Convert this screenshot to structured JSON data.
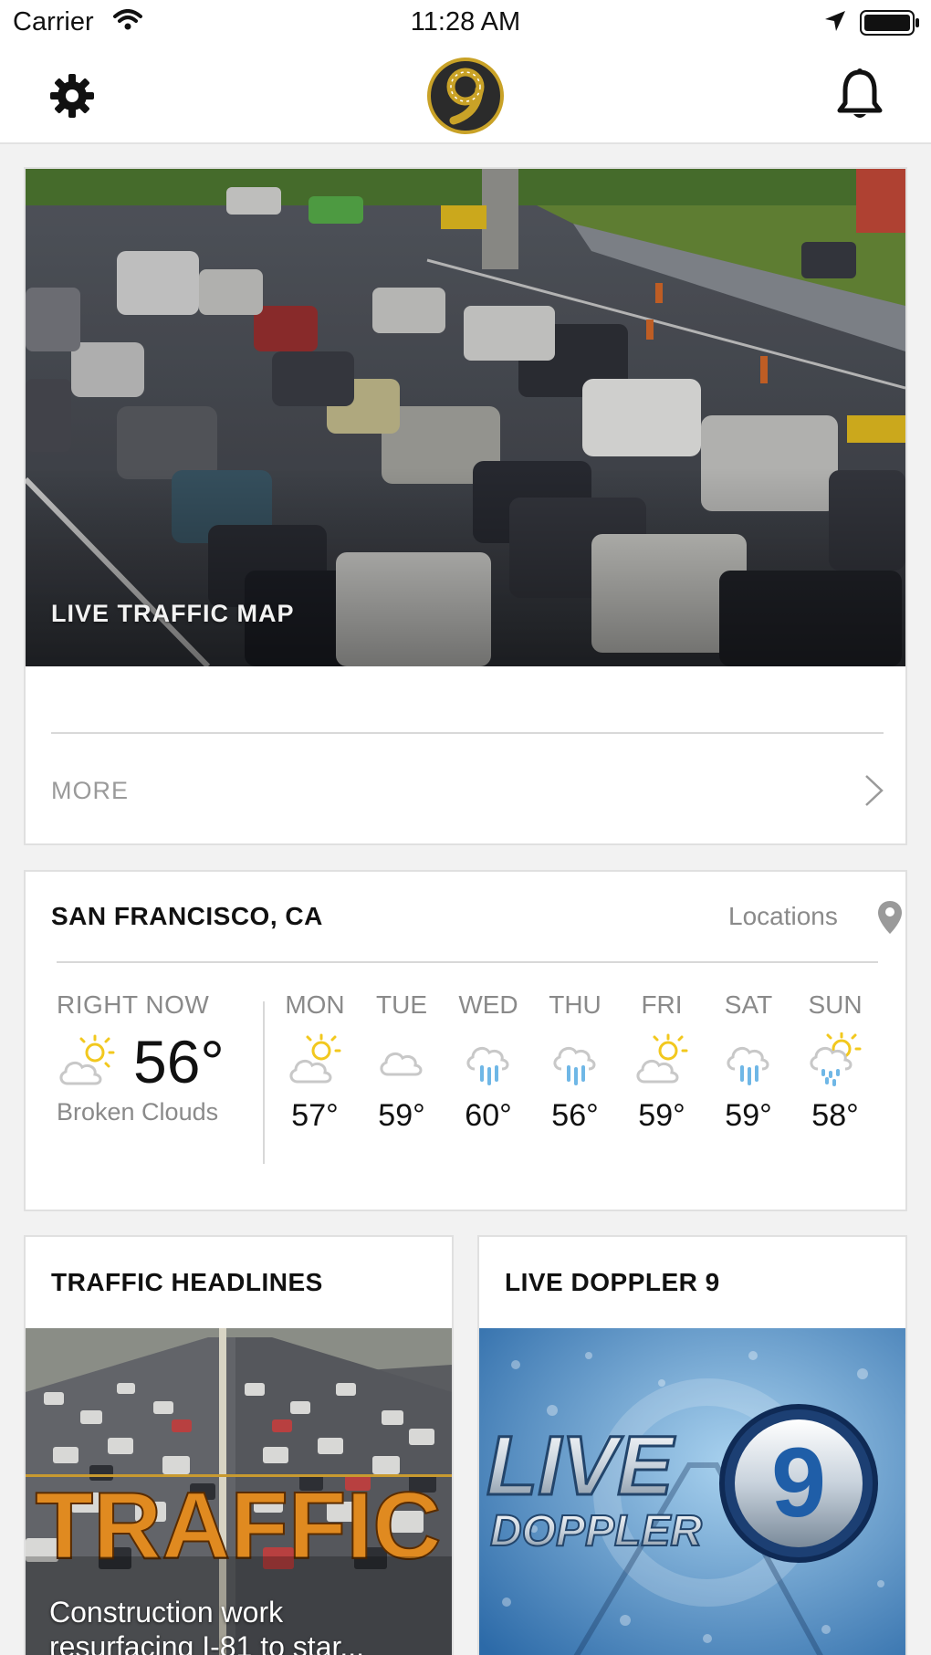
{
  "status_bar": {
    "carrier": "Carrier",
    "time": "11:28 AM",
    "icons": [
      "wifi-icon",
      "location-arrow-icon",
      "battery-icon"
    ]
  },
  "nav_bar": {
    "left_icon": "gear-icon",
    "logo": "channel-9-logo",
    "right_icon": "bell-icon"
  },
  "traffic_map_card": {
    "image_label": "LIVE TRAFFIC MAP",
    "more_label": "MORE",
    "more_icon": "chevron-right-icon"
  },
  "weather_card": {
    "city": "SAN FRANCISCO, CA",
    "locations_label": "Locations",
    "locations_icon": "map-pin-icon",
    "current": {
      "label": "RIGHT NOW",
      "temp": "56°",
      "condition": "Broken Clouds",
      "icon": "partly-sunny-icon"
    },
    "forecast": [
      {
        "day": "MON",
        "temp": "57°",
        "icon": "partly-sunny-icon"
      },
      {
        "day": "TUE",
        "temp": "59°",
        "icon": "cloud-icon"
      },
      {
        "day": "WED",
        "temp": "60°",
        "icon": "rain-icon"
      },
      {
        "day": "THU",
        "temp": "56°",
        "icon": "rain-icon"
      },
      {
        "day": "FRI",
        "temp": "59°",
        "icon": "partly-sunny-icon"
      },
      {
        "day": "SAT",
        "temp": "59°",
        "icon": "rain-icon"
      },
      {
        "day": "SUN",
        "temp": "58°",
        "icon": "sun-showers-icon"
      }
    ]
  },
  "traffic_headlines_card": {
    "title": "TRAFFIC HEADLINES",
    "image_text": "TRAFFIC",
    "caption": "Construction work resurfacing I-81 to star..."
  },
  "doppler_card": {
    "title": "LIVE DOPPLER 9",
    "image_text_line1": "LIVE",
    "image_text_line2": "DOPPLER",
    "image_badge": "9"
  },
  "colors": {
    "accent_gold": "#c9a227",
    "sun_yellow": "#f2c81e",
    "rain_blue": "#6fb7e6",
    "muted_text": "#8a8a8a"
  }
}
